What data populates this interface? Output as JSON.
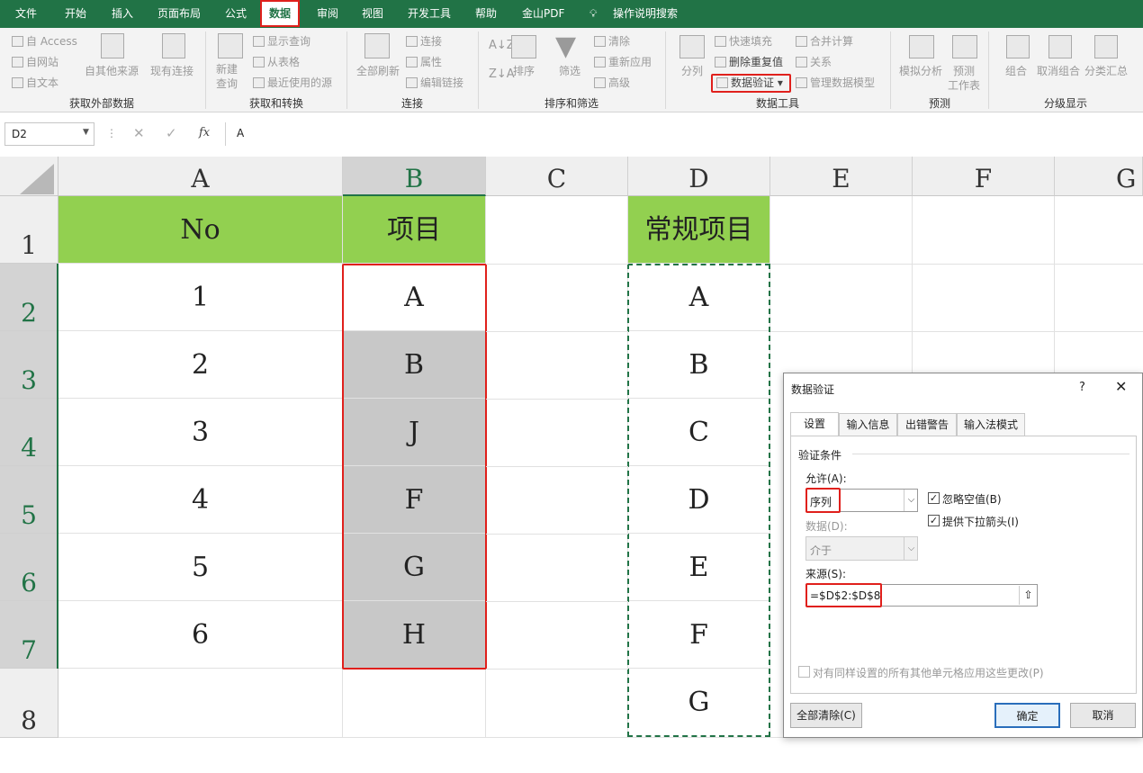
{
  "menu": {
    "items": [
      "文件",
      "开始",
      "插入",
      "页面布局",
      "公式",
      "数据",
      "审阅",
      "视图",
      "开发工具",
      "帮助",
      "金山PDF"
    ],
    "active": "数据",
    "search": "操作说明搜索"
  },
  "ribbon": {
    "get_external": {
      "access": "自 Access",
      "web": "自网站",
      "text": "自文本",
      "other": "自其他来源",
      "existing": "现有连接",
      "label": "获取外部数据"
    },
    "get_transform": {
      "new_query": "新建\n查询",
      "show_query": "显示查询",
      "from_table": "从表格",
      "recent": "最近使用的源",
      "label": "获取和转换"
    },
    "connections": {
      "refresh_all": "全部刷新",
      "connections": "连接",
      "properties": "属性",
      "edit_links": "编辑链接",
      "label": "连接"
    },
    "sort_filter": {
      "sort": "排序",
      "filter": "筛选",
      "clear": "清除",
      "reapply": "重新应用",
      "advanced": "高级",
      "label": "排序和筛选"
    },
    "data_tools": {
      "text_to_cols": "分列",
      "flash_fill": "快速填充",
      "remove_dup": "删除重复值",
      "validation": "数据验证",
      "consolidate": "合并计算",
      "relations": "关系",
      "data_model": "管理数据模型",
      "label": "数据工具"
    },
    "forecast": {
      "what_if": "模拟分析",
      "forecast_sheet": "预测\n工作表",
      "label": "预测"
    },
    "outline": {
      "group": "组合",
      "ungroup": "取消组合",
      "subtotal": "分类汇总",
      "label": "分级显示"
    }
  },
  "formula_bar": {
    "name_box": "D2",
    "formula": "A"
  },
  "sheet": {
    "columns": [
      "A",
      "B",
      "C",
      "D",
      "E",
      "F",
      "G"
    ],
    "rows": [
      "1",
      "2",
      "3",
      "4",
      "5",
      "6",
      "7",
      "8"
    ],
    "A": [
      "No",
      "1",
      "2",
      "3",
      "4",
      "5",
      "6",
      ""
    ],
    "B": [
      "项目",
      "A",
      "B",
      "J",
      "F",
      "G",
      "H",
      ""
    ],
    "D": [
      "常规项目",
      "A",
      "B",
      "C",
      "D",
      "E",
      "F",
      "G"
    ]
  },
  "dialog": {
    "title": "数据验证",
    "help": "?",
    "tabs": [
      "设置",
      "输入信息",
      "出错警告",
      "输入法模式"
    ],
    "section": "验证条件",
    "allow_label": "允许(A):",
    "allow_value": "序列",
    "data_label": "数据(D):",
    "data_value": "介于",
    "ignore_blank": "忽略空值(B)",
    "dropdown": "提供下拉箭头(I)",
    "source_label": "来源(S):",
    "source_value": "=$D$2:$D$8",
    "apply_all": "对有同样设置的所有其他单元格应用这些更改(P)",
    "clear_all": "全部清除(C)",
    "ok": "确定",
    "cancel": "取消"
  },
  "colors": {
    "brand": "#217346",
    "header_fill": "#92d050",
    "highlight": "#e0201c",
    "selection": "#c8c8c8"
  }
}
